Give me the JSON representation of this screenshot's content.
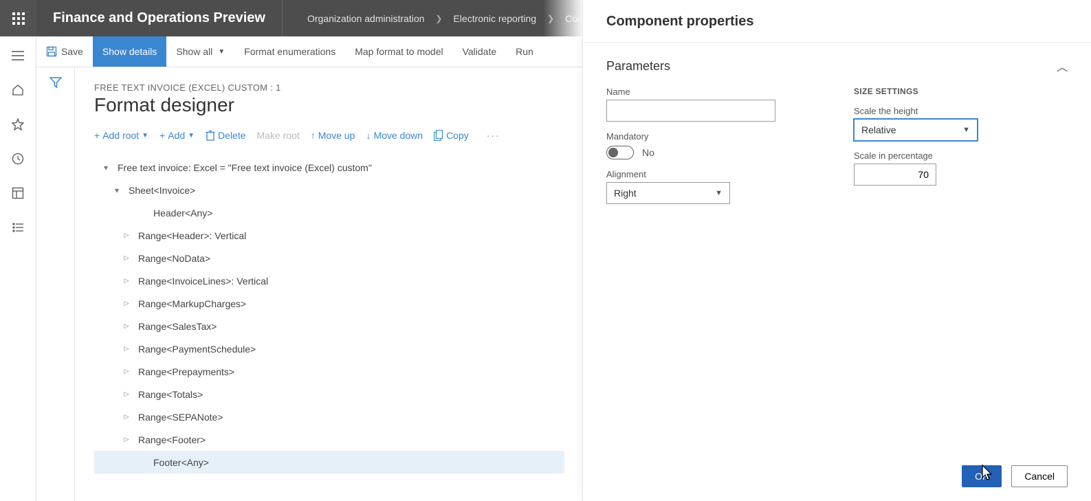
{
  "header": {
    "app_title": "Finance and Operations Preview",
    "breadcrumb": [
      "Organization administration",
      "Electronic reporting",
      "Configurations"
    ]
  },
  "commandbar": {
    "save": "Save",
    "show_details": "Show details",
    "show_all": "Show all",
    "format_enum": "Format enumerations",
    "map_format": "Map format to model",
    "validate": "Validate",
    "run": "Run"
  },
  "main": {
    "subhead": "FREE TEXT INVOICE (EXCEL) CUSTOM : 1",
    "title": "Format designer",
    "toolbar": {
      "add_root": "Add root",
      "add": "Add",
      "delete": "Delete",
      "make_root": "Make root",
      "move_up": "Move up",
      "move_down": "Move down",
      "copy": "Copy"
    },
    "tree": [
      {
        "indent": 0,
        "exp": "down",
        "label": "Free text invoice: Excel = \"Free text invoice (Excel) custom\""
      },
      {
        "indent": 1,
        "exp": "down",
        "label": "Sheet<Invoice>"
      },
      {
        "indent": 3,
        "exp": "none",
        "label": "Header<Any>"
      },
      {
        "indent": 2,
        "exp": "right",
        "label": "Range<Header>: Vertical"
      },
      {
        "indent": 2,
        "exp": "right",
        "label": "Range<NoData>"
      },
      {
        "indent": 2,
        "exp": "right",
        "label": "Range<InvoiceLines>: Vertical"
      },
      {
        "indent": 2,
        "exp": "right",
        "label": "Range<MarkupCharges>"
      },
      {
        "indent": 2,
        "exp": "right",
        "label": "Range<SalesTax>"
      },
      {
        "indent": 2,
        "exp": "right",
        "label": "Range<PaymentSchedule>"
      },
      {
        "indent": 2,
        "exp": "right",
        "label": "Range<Prepayments>"
      },
      {
        "indent": 2,
        "exp": "right",
        "label": "Range<Totals>"
      },
      {
        "indent": 2,
        "exp": "right",
        "label": "Range<SEPANote>"
      },
      {
        "indent": 2,
        "exp": "right",
        "label": "Range<Footer>"
      },
      {
        "indent": 3,
        "exp": "none",
        "label": "Footer<Any>",
        "selected": true
      }
    ]
  },
  "panel": {
    "title": "Component properties",
    "section": "Parameters",
    "name_label": "Name",
    "name_value": "",
    "mandatory_label": "Mandatory",
    "mandatory_value": "No",
    "alignment_label": "Alignment",
    "alignment_value": "Right",
    "size_heading": "SIZE SETTINGS",
    "scale_height_label": "Scale the height",
    "scale_height_value": "Relative",
    "scale_pct_label": "Scale in percentage",
    "scale_pct_value": "70",
    "ok": "OK",
    "cancel": "Cancel"
  }
}
